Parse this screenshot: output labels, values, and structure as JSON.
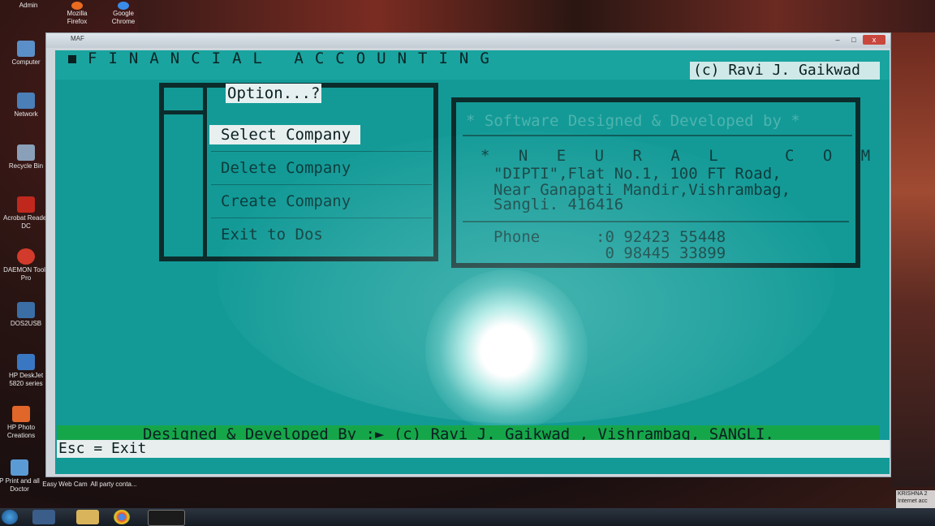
{
  "desktop": {
    "top_icons": [
      {
        "label": "Admin",
        "icon": "user-folder-icon"
      },
      {
        "label": "Mozilla Firefox",
        "icon": "firefox-icon"
      },
      {
        "label": "Google Chrome",
        "icon": "chrome-icon"
      }
    ],
    "side_icons": [
      {
        "label": "Computer",
        "icon": "computer-icon",
        "color": "#5b8fc7"
      },
      {
        "label": "Network",
        "icon": "network-icon",
        "color": "#4a7fb8"
      },
      {
        "label": "Recycle Bin",
        "icon": "recycle-bin-icon",
        "color": "#8aa0b8"
      },
      {
        "label": "Acrobat Reader DC",
        "icon": "acrobat-icon",
        "color": "#c0281e"
      },
      {
        "label": "DAEMON Tools Pro",
        "icon": "daemon-tools-icon",
        "color": "#d23b2b"
      },
      {
        "label": "DOS2USB",
        "icon": "dos2usb-icon",
        "color": "#3a6ea5"
      },
      {
        "label": "HP DeskJet 5820 series",
        "icon": "printer-icon",
        "color": "#3a77c2"
      },
      {
        "label": "HP Photo Creations",
        "icon": "photo-icon",
        "color": "#e0662a"
      },
      {
        "label": "P Print and all Doctor",
        "icon": "print-doctor-icon",
        "color": "#5b9bd5"
      }
    ],
    "bottom_icons": [
      {
        "label": "Easy Web Cam",
        "icon": "webcam-icon"
      },
      {
        "label": "All party conta...",
        "icon": "document-icon"
      }
    ]
  },
  "window": {
    "title": "MAF",
    "minimize_label": "–",
    "maximize_label": "□",
    "close_label": "x"
  },
  "app": {
    "title": "FINANCIAL ACCOUNTING",
    "copyright": "(c) Ravi J. Gaikwad",
    "option_prompt": "Option...?",
    "menu": [
      {
        "label": "Select Company",
        "selected": true
      },
      {
        "label": "Delete Company",
        "selected": false
      },
      {
        "label": "Create Company",
        "selected": false
      },
      {
        "label": "Exit to Dos",
        "selected": false
      }
    ],
    "info": {
      "heading": "* Software Designed & Developed by *",
      "company": "* N E U R A L   C O M P U T E R S",
      "address_1": "\"DIPTI\",Flat No.1, 100 FT Road,",
      "address_2": "Near Ganapati Mandir,Vishrambag,",
      "address_3": "Sangli. 416416",
      "phone_label": "Phone",
      "phone_1": ":0 92423 55448",
      "phone_2": " 0 98445 33899"
    },
    "footer_designed": "Designed & Developed By :► (c) Ravi J. Gaikwad , Vishrambag, SANGLI.",
    "footer_esc": "Esc = Exit",
    "colors": {
      "screen": "#139a97",
      "footer_green": "#16a64a",
      "highlight": "#e8efef"
    }
  },
  "taskbar": {
    "tray_name": "KRISHNA 2",
    "tray_status": "Internet acc"
  }
}
